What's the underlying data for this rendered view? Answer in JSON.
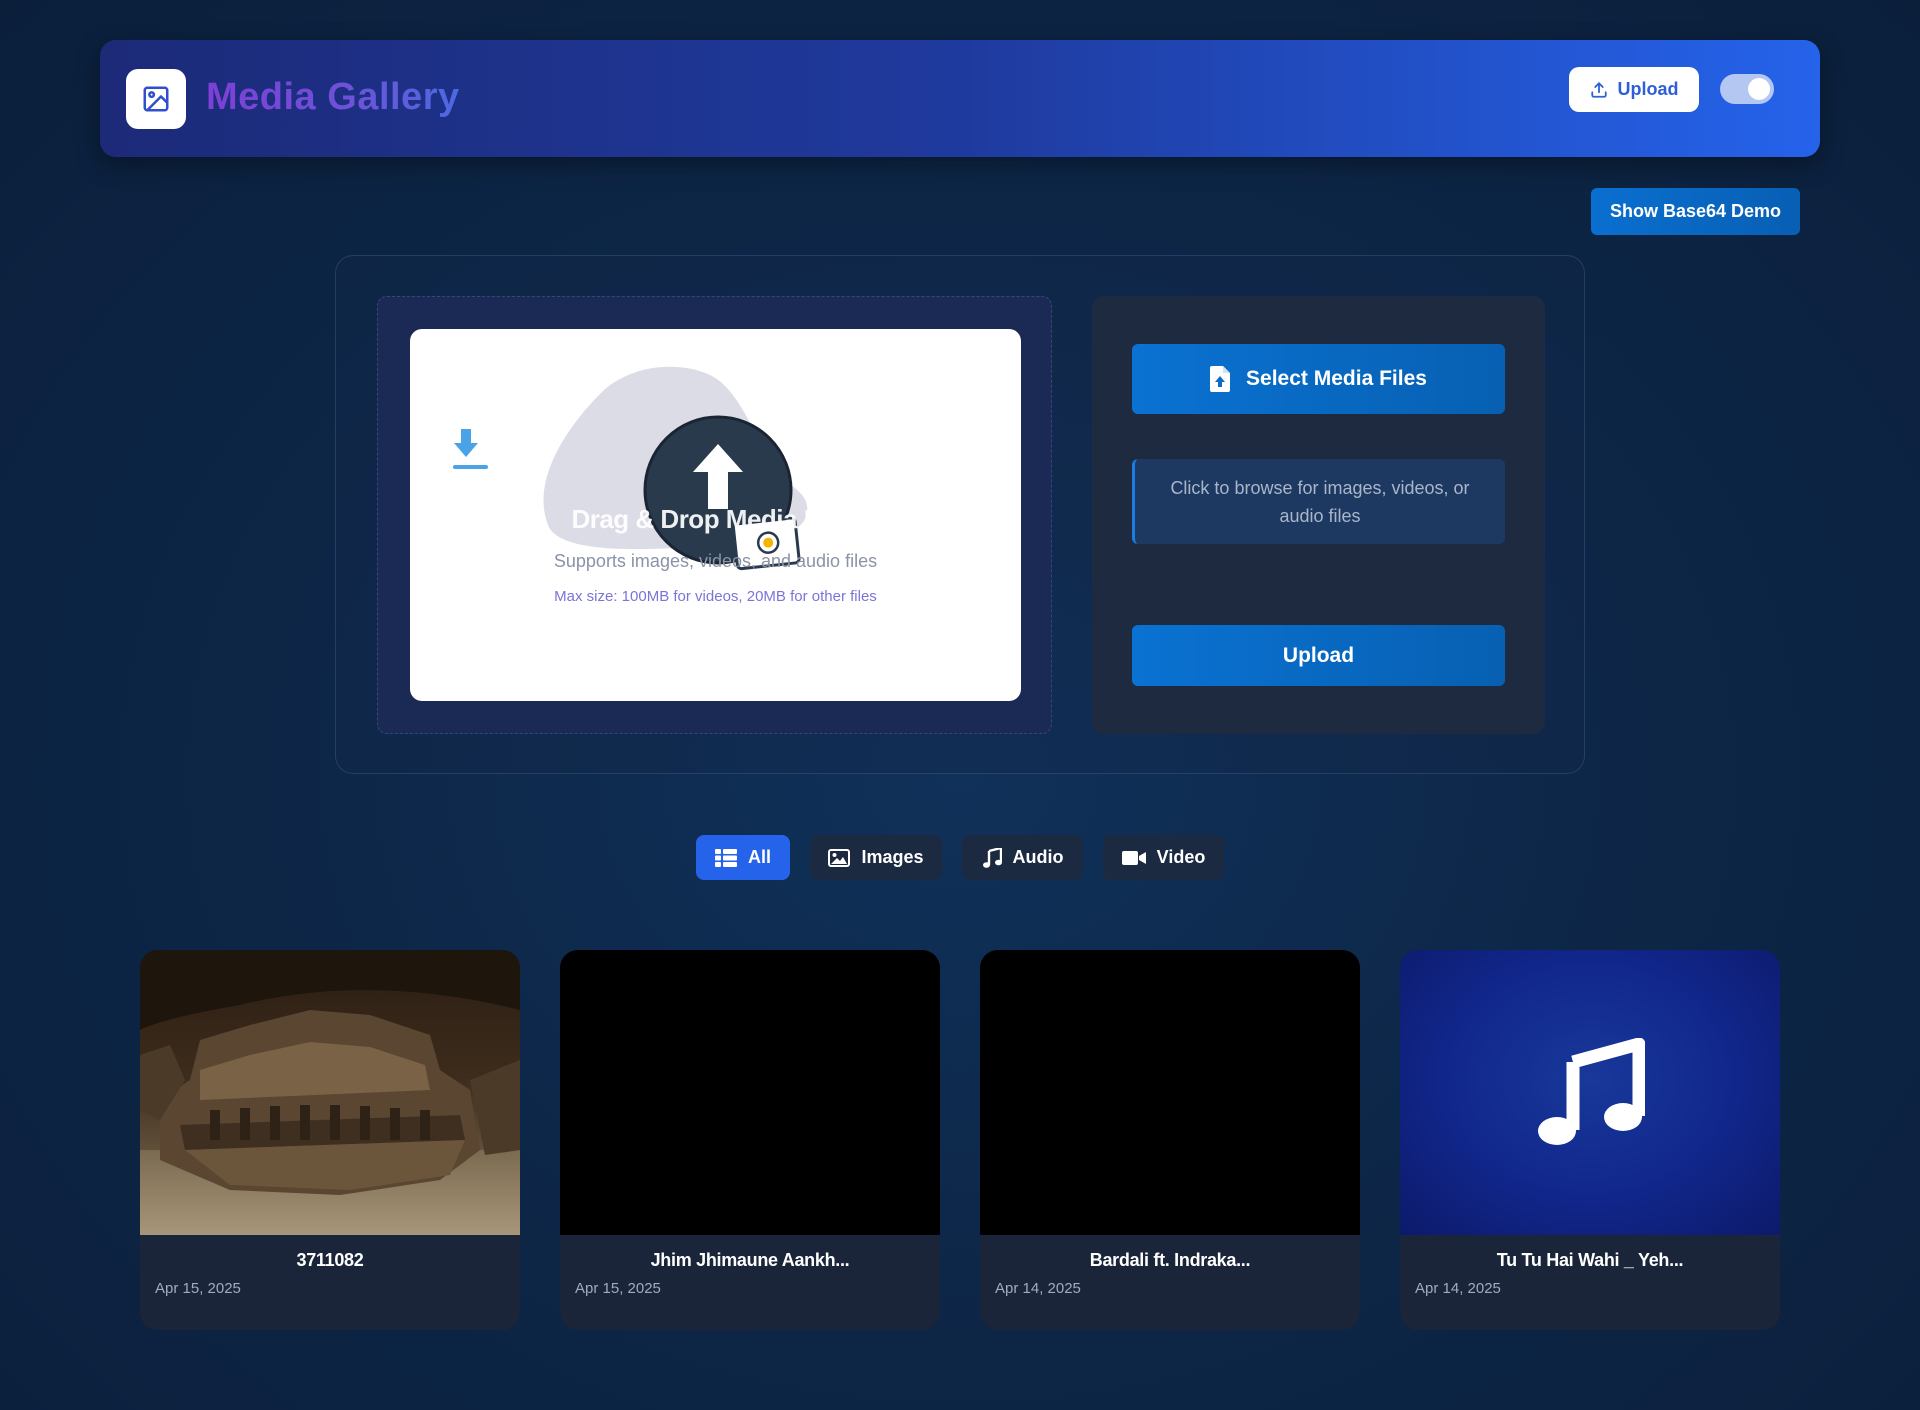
{
  "header": {
    "title": "Media Gallery",
    "upload_label": "Upload",
    "theme_toggle_on": true
  },
  "base64_button": "Show Base64 Demo",
  "dropzone": {
    "title": "Drag & Drop Media Here",
    "subtitle": "Supports images, videos, and audio files",
    "max_size": "Max size: 100MB for videos, 20MB for other files"
  },
  "side": {
    "select_label": "Select Media Files",
    "browse_hint": "Click to browse for images, videos, or audio files",
    "upload_label": "Upload"
  },
  "filters": [
    {
      "label": "All",
      "icon": "list-icon",
      "active": true
    },
    {
      "label": "Images",
      "icon": "image-icon",
      "active": false
    },
    {
      "label": "Audio",
      "icon": "music-icon",
      "active": false
    },
    {
      "label": "Video",
      "icon": "video-camera-icon",
      "active": false
    }
  ],
  "media": [
    {
      "name": "3711082",
      "date": "Apr 15, 2025",
      "type": "image"
    },
    {
      "name": "Jhim Jhimaune Aankh...",
      "date": "Apr 15, 2025",
      "type": "video"
    },
    {
      "name": "Bardali ft. Indraka...",
      "date": "Apr 14, 2025",
      "type": "video"
    },
    {
      "name": "Tu Tu Hai Wahi _ Yeh...",
      "date": "Apr 14, 2025",
      "type": "audio"
    }
  ],
  "colors": {
    "accent": "#2563eb",
    "button_blue": "#0a72d2",
    "title_purple": "#7e3fd6"
  }
}
